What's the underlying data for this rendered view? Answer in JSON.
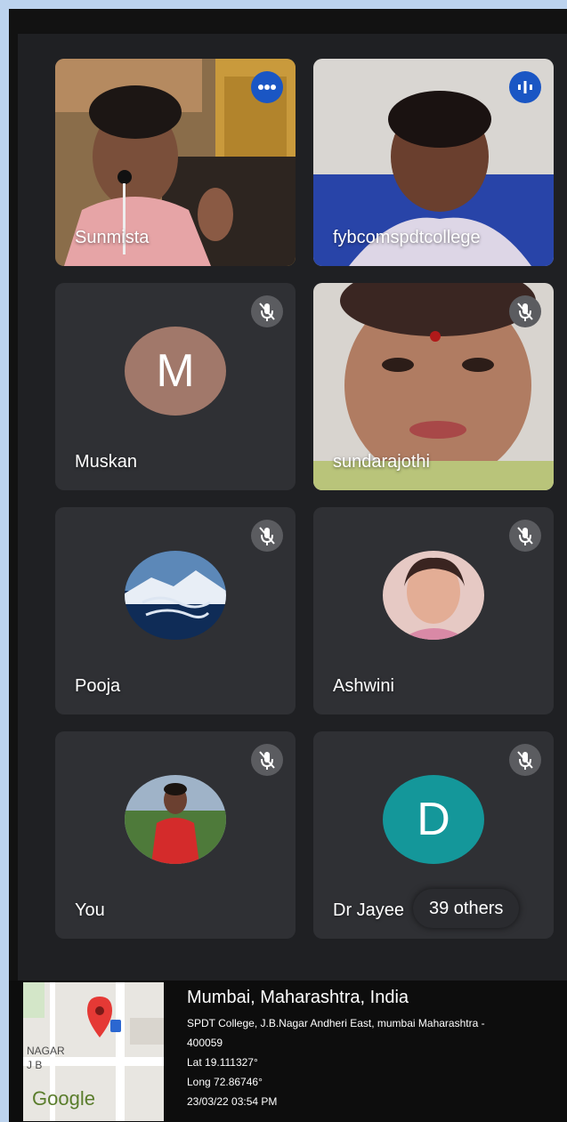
{
  "participants": [
    {
      "name": "Sunmista",
      "kind": "video",
      "status_icon": "speaking-indicator-icon"
    },
    {
      "name": "fybcomspdtcollege",
      "kind": "video",
      "status_icon": "speaking-indicator-icon"
    },
    {
      "name": "Muskan",
      "kind": "letter",
      "initial": "M",
      "avatar_color": "#a1786a",
      "status_icon": "mic-off-icon"
    },
    {
      "name": "sundarajothi",
      "kind": "video",
      "status_icon": "mic-off-icon"
    },
    {
      "name": "Pooja",
      "kind": "photo",
      "status_icon": "mic-off-icon"
    },
    {
      "name": "Ashwini",
      "kind": "photo",
      "status_icon": "mic-off-icon"
    },
    {
      "name": "You",
      "kind": "photo",
      "status_icon": "mic-off-icon"
    },
    {
      "name": "Dr Jayee",
      "kind": "letter",
      "initial": "D",
      "avatar_color": "#14979a",
      "status_icon": "mic-off-icon"
    }
  ],
  "others_label": "39 others",
  "geotag": {
    "city": "Mumbai, Maharashtra, India",
    "address_line1": "SPDT College, J.B.Nagar Andheri East, mumbai Maharashtra -",
    "address_line2": "400059",
    "lat": "Lat 19.111327°",
    "long": "Long 72.86746°",
    "datetime": "23/03/22 03:54 PM",
    "map_label_1": "NAGAR",
    "map_label_2": "J B",
    "map_brand": "Google"
  },
  "colors": {
    "accent_blue": "#1a56c4",
    "tile_bg": "#3a3b3f",
    "meet_bg": "#1f2023"
  }
}
